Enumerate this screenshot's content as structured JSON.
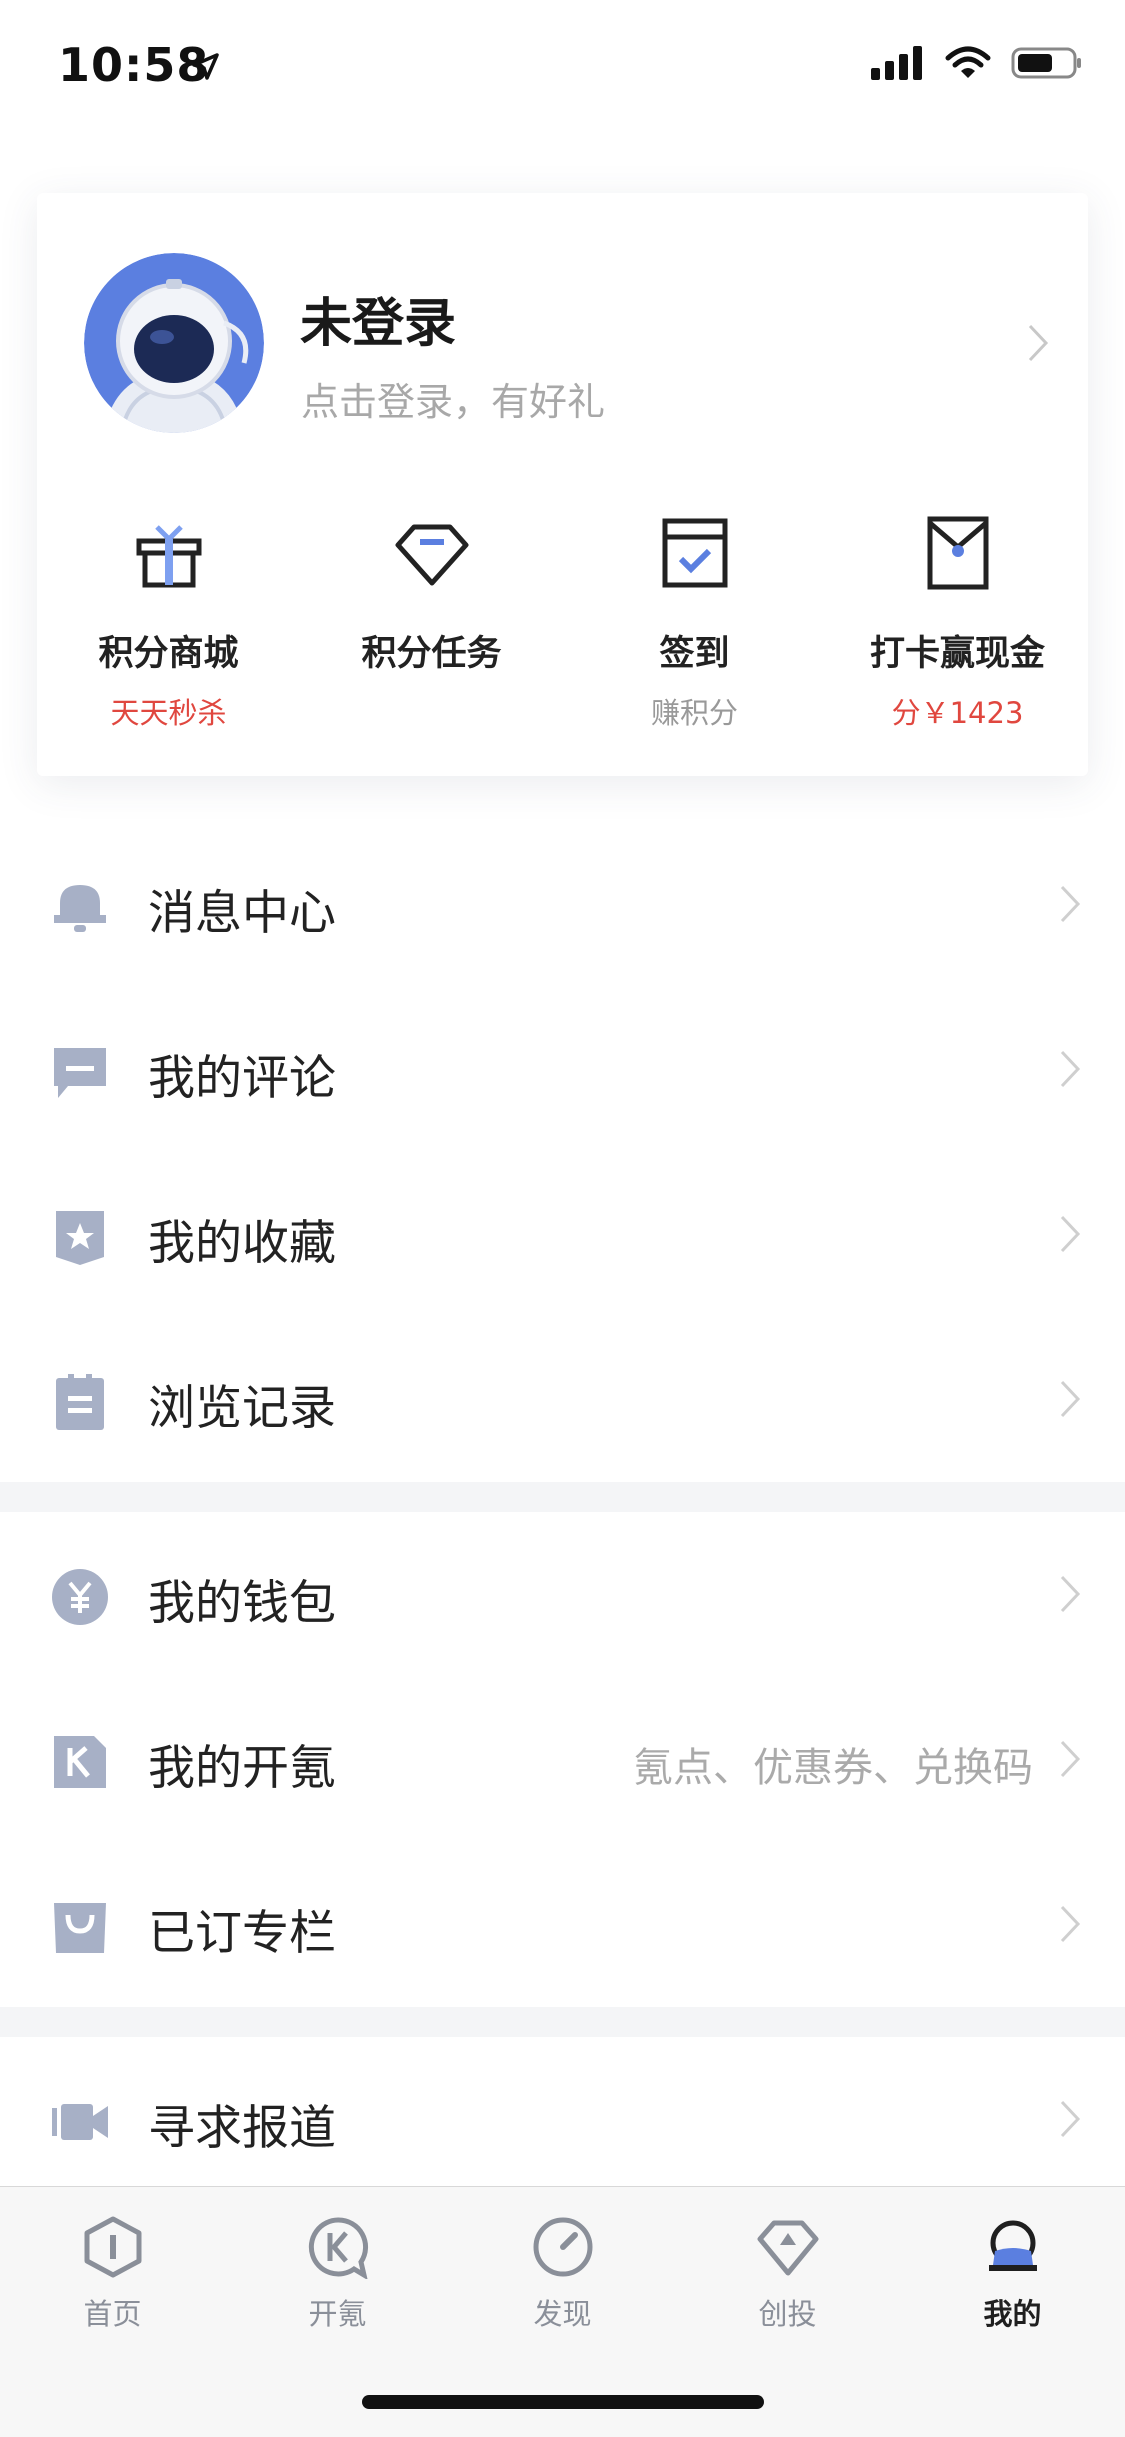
{
  "status_bar": {
    "time": "10:58"
  },
  "profile": {
    "title": "未登录",
    "subtitle": "点击登录，有好礼"
  },
  "quick_actions": [
    {
      "label": "积分商城",
      "sub": "天天秒杀",
      "icon": "gift-icon"
    },
    {
      "label": "积分任务",
      "sub": "",
      "icon": "diamond-icon"
    },
    {
      "label": "签到",
      "sub": "赚积分",
      "icon": "checkin-icon"
    },
    {
      "label": "打卡赢现金",
      "sub": "分￥1423",
      "icon": "envelope-icon"
    }
  ],
  "menu_group1": [
    {
      "label": "消息中心",
      "icon": "bell-icon"
    },
    {
      "label": "我的评论",
      "icon": "comment-icon"
    },
    {
      "label": "我的收藏",
      "icon": "bookmark-star-icon"
    },
    {
      "label": "浏览记录",
      "icon": "clipboard-icon"
    }
  ],
  "menu_group2": [
    {
      "label": "我的钱包",
      "icon": "yen-coin-icon",
      "value": ""
    },
    {
      "label": "我的开氪",
      "icon": "k-badge-icon",
      "value": "氪点、优惠券、兑换码"
    },
    {
      "label": "已订专栏",
      "icon": "shopping-bag-icon",
      "value": ""
    }
  ],
  "menu_group3": [
    {
      "label": "寻求报道",
      "icon": "video-camera-icon"
    }
  ],
  "tab_bar": [
    {
      "label": "首页",
      "icon": "home-hexagon-icon",
      "active": false
    },
    {
      "label": "开氪",
      "icon": "k-bubble-icon",
      "active": false
    },
    {
      "label": "发现",
      "icon": "compass-icon",
      "active": false
    },
    {
      "label": "创投",
      "icon": "diamond-tab-icon",
      "active": false
    },
    {
      "label": "我的",
      "icon": "profile-icon",
      "active": true
    }
  ],
  "colors": {
    "accent_blue": "#5b7fe0",
    "icon_gray": "#a7b0c6",
    "highlight_red": "#e0473f",
    "separator": "#f4f5f7"
  }
}
